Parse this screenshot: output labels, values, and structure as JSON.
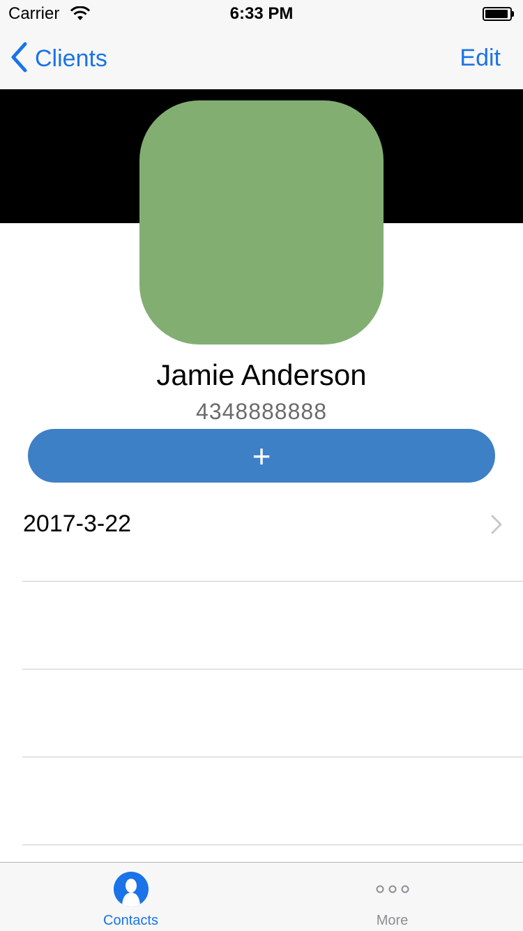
{
  "status_bar": {
    "carrier": "Carrier",
    "time": "6:33 PM",
    "icons": [
      "wifi-icon",
      "battery-icon"
    ]
  },
  "nav": {
    "back_label": "Clients",
    "edit_label": "Edit",
    "accent_color": "#1a73e8"
  },
  "profile": {
    "name": "Jamie Anderson",
    "phone": "4348888888",
    "avatar_color": "#82ae72",
    "add_button_label": "+",
    "add_button_color": "#3e80c6"
  },
  "list": {
    "rows": [
      {
        "label": "2017-3-22",
        "has_disclosure": true
      },
      {
        "label": ""
      },
      {
        "label": ""
      },
      {
        "label": ""
      }
    ]
  },
  "tab_bar": {
    "tabs": [
      {
        "label": "Contacts",
        "icon": "contacts-icon",
        "active": true
      },
      {
        "label": "More",
        "icon": "more-icon",
        "active": false
      }
    ]
  }
}
